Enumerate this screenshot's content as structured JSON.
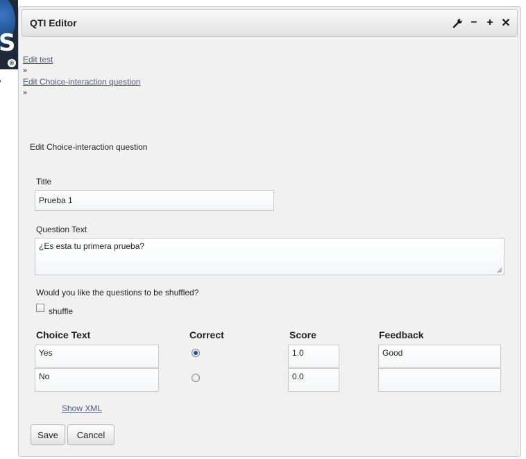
{
  "logo": {
    "letter": "S",
    "registered": "®"
  },
  "portlet": {
    "title": "QTI Editor",
    "icons": [
      "wrench-icon",
      "minimize-icon",
      "maximize-icon",
      "close-icon"
    ],
    "icon_glyphs": {
      "wrench": "🔧",
      "minimize": "−",
      "maximize": "+",
      "close": "✕"
    }
  },
  "breadcrumbs": [
    {
      "label": "Edit test",
      "separator": "»"
    },
    {
      "label": "Edit Choice-interaction question",
      "separator": "»"
    }
  ],
  "page_subtitle": "Edit Choice-interaction question",
  "form": {
    "title_label": "Title",
    "title_value": "Prueba 1",
    "question_label": "Question Text",
    "question_value": "¿Es esta tu primera prueba?",
    "shuffle_prompt": "Would you like the questions to be shuffled?",
    "shuffle_label": "shuffle",
    "shuffle_checked": false
  },
  "choices": {
    "headers": {
      "text": "Choice Text",
      "correct": "Correct",
      "score": "Score",
      "feedback": "Feedback"
    },
    "rows": [
      {
        "text": "Yes",
        "correct": true,
        "score": "1.0",
        "feedback": "Good"
      },
      {
        "text": "No",
        "correct": false,
        "score": "0.0",
        "feedback": ""
      }
    ]
  },
  "show_xml_label": "Show XML",
  "buttons": {
    "save": "Save",
    "cancel": "Cancel"
  },
  "colors": {
    "link": "#4e5a7c",
    "radio_selected": "#1d4f9a"
  }
}
